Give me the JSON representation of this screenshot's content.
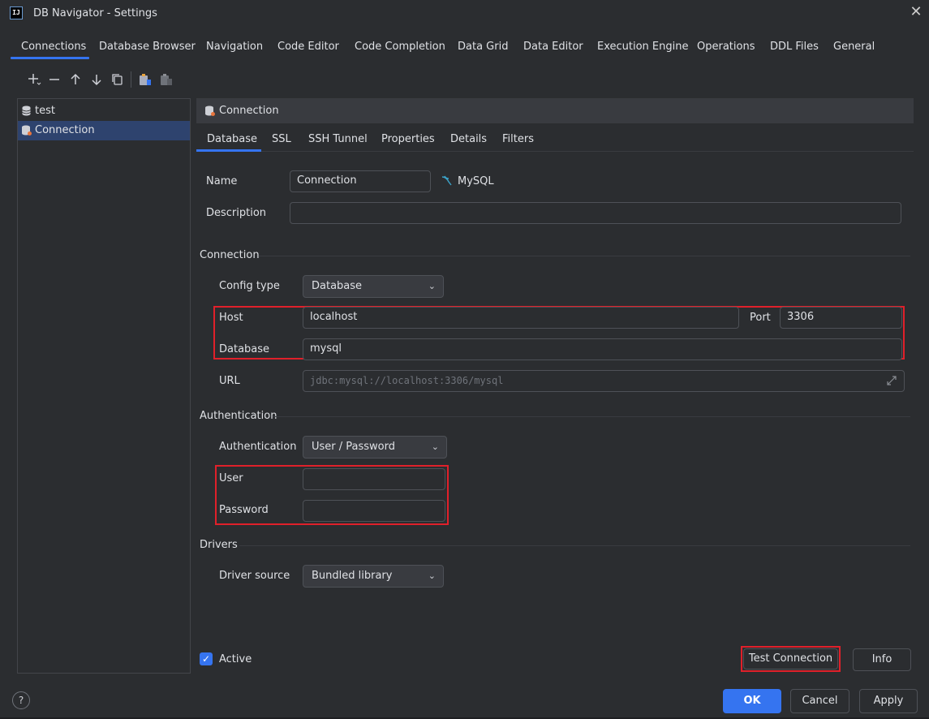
{
  "window": {
    "title": "DB Navigator - Settings",
    "logo": "IJ"
  },
  "main_tabs": [
    "Connections",
    "Database Browser",
    "Navigation",
    "Code Editor",
    "Code Completion",
    "Data Grid",
    "Data Editor",
    "Execution Engine",
    "Operations",
    "DDL Files",
    "General"
  ],
  "toolbar": {
    "icons": [
      "add-icon",
      "remove-icon",
      "move-up-icon",
      "move-down-icon",
      "duplicate-icon",
      "copy-icon",
      "paste-icon"
    ]
  },
  "tree": {
    "items": [
      {
        "label": "test",
        "icon": "database-icon"
      },
      {
        "label": "Connection",
        "icon": "database-new-icon"
      }
    ]
  },
  "connection_header": "Connection",
  "sub_tabs": [
    "Database",
    "SSL",
    "SSH Tunnel",
    "Properties",
    "Details",
    "Filters"
  ],
  "form": {
    "name_label": "Name",
    "name_value": "Connection",
    "db_type": "MySQL",
    "description_label": "Description",
    "description_value": "",
    "connection_section": "Connection",
    "config_type_label": "Config type",
    "config_type_value": "Database",
    "host_label": "Host",
    "host_value": "localhost",
    "port_label": "Port",
    "port_value": "3306",
    "database_label": "Database",
    "database_value": "mysql",
    "url_label": "URL",
    "url_value": "jdbc:mysql://localhost:3306/mysql",
    "auth_section": "Authentication",
    "auth_label": "Authentication",
    "auth_value": "User / Password",
    "user_label": "User",
    "user_value": "",
    "password_label": "Password",
    "password_value": "",
    "drivers_section": "Drivers",
    "driver_source_label": "Driver source",
    "driver_source_value": "Bundled library",
    "active_label": "Active",
    "active_checked": true
  },
  "buttons": {
    "test_connection": "Test Connection",
    "info": "Info",
    "ok": "OK",
    "cancel": "Cancel",
    "apply": "Apply",
    "help": "?"
  },
  "colors": {
    "accent": "#3574f0",
    "highlight": "#e0202a",
    "background": "#2b2d30"
  }
}
